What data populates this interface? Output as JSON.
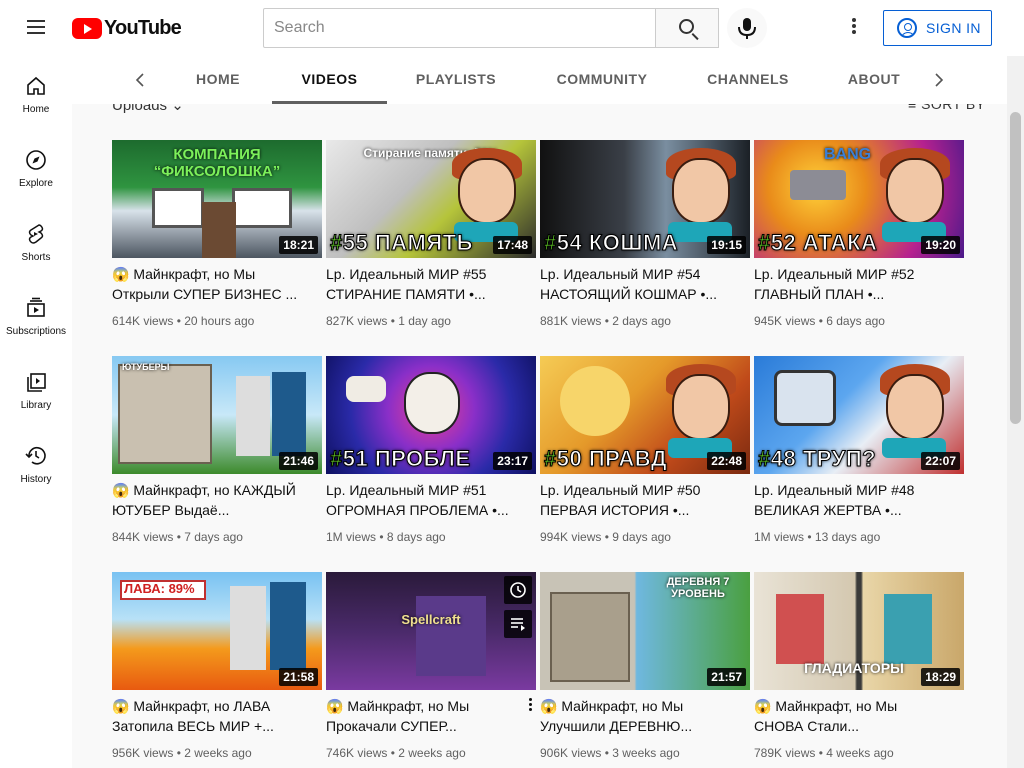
{
  "app": {
    "logo_text": "YouTube",
    "brand_color": "#ff0000",
    "accent_color": "#065fd4"
  },
  "search": {
    "placeholder": "Search",
    "value": ""
  },
  "header": {
    "sign_in_label": "SIGN IN"
  },
  "sidebar": {
    "items": [
      {
        "label": "Home",
        "icon": "home-icon"
      },
      {
        "label": "Explore",
        "icon": "compass-icon"
      },
      {
        "label": "Shorts",
        "icon": "shorts-icon"
      },
      {
        "label": "Subscriptions",
        "icon": "subscriptions-icon"
      },
      {
        "label": "Library",
        "icon": "library-icon"
      },
      {
        "label": "History",
        "icon": "history-icon"
      }
    ]
  },
  "tabs": {
    "items": [
      "HOME",
      "VIDEOS",
      "PLAYLISTS",
      "COMMUNITY",
      "CHANNELS",
      "ABOUT"
    ],
    "active": "VIDEOS"
  },
  "content": {
    "uploads_label": "Uploads",
    "sort_label": "SORT BY"
  },
  "videos": [
    {
      "title": "😱 Майнкрафт, но Мы Открыли СУПЕР БИЗНЕС ...",
      "views": "614K views",
      "age": "20 hours ago",
      "duration": "18:21",
      "thumb_text": "КОМПАНИЯ “ФИКСОЛОШКА”",
      "thumb_number": ""
    },
    {
      "title": "Lp. Идеальный МИР #55 СТИРАНИЕ ПАМЯТИ •...",
      "views": "827K views",
      "age": "1 day ago",
      "duration": "17:48",
      "thumb_text": "Стирание памяти: 76%",
      "thumb_number": "55 ПАМЯТЬ"
    },
    {
      "title": "Lp. Идеальный МИР #54 НАСТОЯЩИЙ КОШМАР •...",
      "views": "881K views",
      "age": "2 days ago",
      "duration": "19:15",
      "thumb_text": "",
      "thumb_number": "54 КОШМА"
    },
    {
      "title": "Lp. Идеальный МИР #52 ГЛАВНЫЙ ПЛАН •...",
      "views": "945K views",
      "age": "6 days ago",
      "duration": "19:20",
      "thumb_text": "BANG",
      "thumb_number": "52 АТАКА"
    },
    {
      "title": "😱 Майнкрафт, но КАЖДЫЙ ЮТУБЕР Выдаё...",
      "views": "844K views",
      "age": "7 days ago",
      "duration": "21:46",
      "thumb_text": "ЮТУБЕРЫ",
      "thumb_number": ""
    },
    {
      "title": "Lp. Идеальный МИР #51 ОГРОМНАЯ ПРОБЛЕМА •...",
      "views": "1M views",
      "age": "8 days ago",
      "duration": "23:17",
      "thumb_text": "",
      "thumb_number": "51 ПРОБЛЕ"
    },
    {
      "title": "Lp. Идеальный МИР #50 ПЕРВАЯ ИСТОРИЯ •...",
      "views": "994K views",
      "age": "9 days ago",
      "duration": "22:48",
      "thumb_text": "",
      "thumb_number": "50 ПРАВД"
    },
    {
      "title": "Lp. Идеальный МИР #48 ВЕЛИКАЯ ЖЕРТВА •...",
      "views": "1M views",
      "age": "13 days ago",
      "duration": "22:07",
      "thumb_text": "",
      "thumb_number": "48 ТРУП?"
    },
    {
      "title": "😱 Майнкрафт, но ЛАВА Затопила ВЕСЬ МИР +...",
      "views": "956K views",
      "age": "2 weeks ago",
      "duration": "21:58",
      "thumb_text": "ЛАВА: 89%",
      "thumb_number": ""
    },
    {
      "title": "😱 Майнкрафт, но Мы Прокачали СУПЕР...",
      "views": "746K views",
      "age": "2 weeks ago",
      "duration": "",
      "thumb_text": "Spellcraft",
      "thumb_number": ""
    },
    {
      "title": "😱 Майнкрафт, но Мы Улучшили ДЕРЕВНЮ...",
      "views": "906K views",
      "age": "3 weeks ago",
      "duration": "21:57",
      "thumb_text": "ДЕРЕВНЯ 7 УРОВЕНЬ",
      "thumb_number": ""
    },
    {
      "title": "😱 Майнкрафт, но Мы СНОВА Стали...",
      "views": "789K views",
      "age": "4 weeks ago",
      "duration": "18:29",
      "thumb_text": "ГЛАДИАТОРЫ",
      "thumb_number": ""
    }
  ]
}
